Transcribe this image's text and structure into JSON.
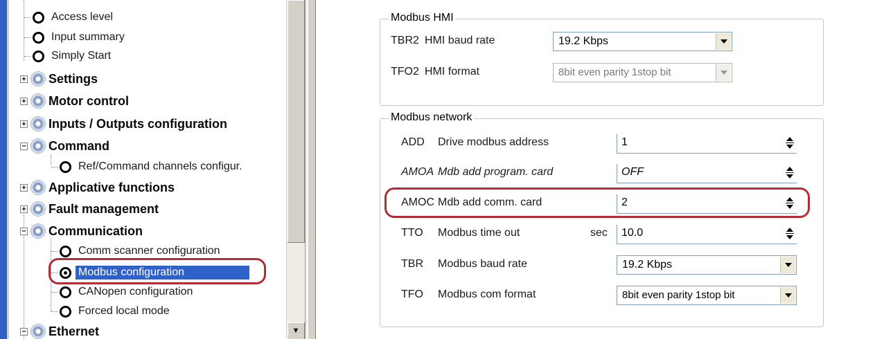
{
  "tree": {
    "top_items": [
      "Access level",
      "Input summary",
      "Simply Start"
    ],
    "categories": {
      "settings": "Settings",
      "motor_control": "Motor control",
      "io_config": "Inputs / Outputs configuration",
      "command": "Command",
      "command_child": "Ref/Command channels configur.",
      "applicative": "Applicative functions",
      "fault": "Fault management",
      "communication": "Communication",
      "ethernet": "Ethernet"
    },
    "communication_children": [
      "Comm scanner configuration",
      "Modbus configuration",
      "CANopen configuration",
      "Forced local mode"
    ],
    "selected": "Modbus configuration",
    "expand_symbols": {
      "collapsed": "+",
      "expanded": "−"
    }
  },
  "modbus_hmi": {
    "legend": "Modbus HMI",
    "rows": [
      {
        "code": "TBR2",
        "label": "HMI baud rate",
        "value": "19.2 Kbps",
        "enabled": true
      },
      {
        "code": "TFO2",
        "label": "HMI format",
        "value": "8bit even parity 1stop bit",
        "enabled": false
      }
    ]
  },
  "modbus_network": {
    "legend": "Modbus network",
    "rows": [
      {
        "code": "ADD",
        "label": "Drive modbus address",
        "value": "1",
        "control": "spin",
        "italic": false
      },
      {
        "code": "AMOA",
        "label": "Mdb add program. card",
        "value": "OFF",
        "control": "spin",
        "italic": true
      },
      {
        "code": "AMOC",
        "label": "Mdb add comm. card",
        "value": "2",
        "control": "spin",
        "italic": false
      },
      {
        "code": "TTO",
        "label": "Modbus time out",
        "unit": "sec",
        "value": "10.0",
        "control": "spin",
        "italic": false
      },
      {
        "code": "TBR",
        "label": "Modbus baud rate",
        "value": "19.2 Kbps",
        "control": "combo",
        "italic": false
      },
      {
        "code": "TFO",
        "label": "Modbus com format",
        "value": "8bit even parity 1stop bit",
        "control": "combo",
        "italic": false
      }
    ]
  },
  "colors": {
    "selection": "#2f62c9",
    "highlight": "#b22d36"
  }
}
